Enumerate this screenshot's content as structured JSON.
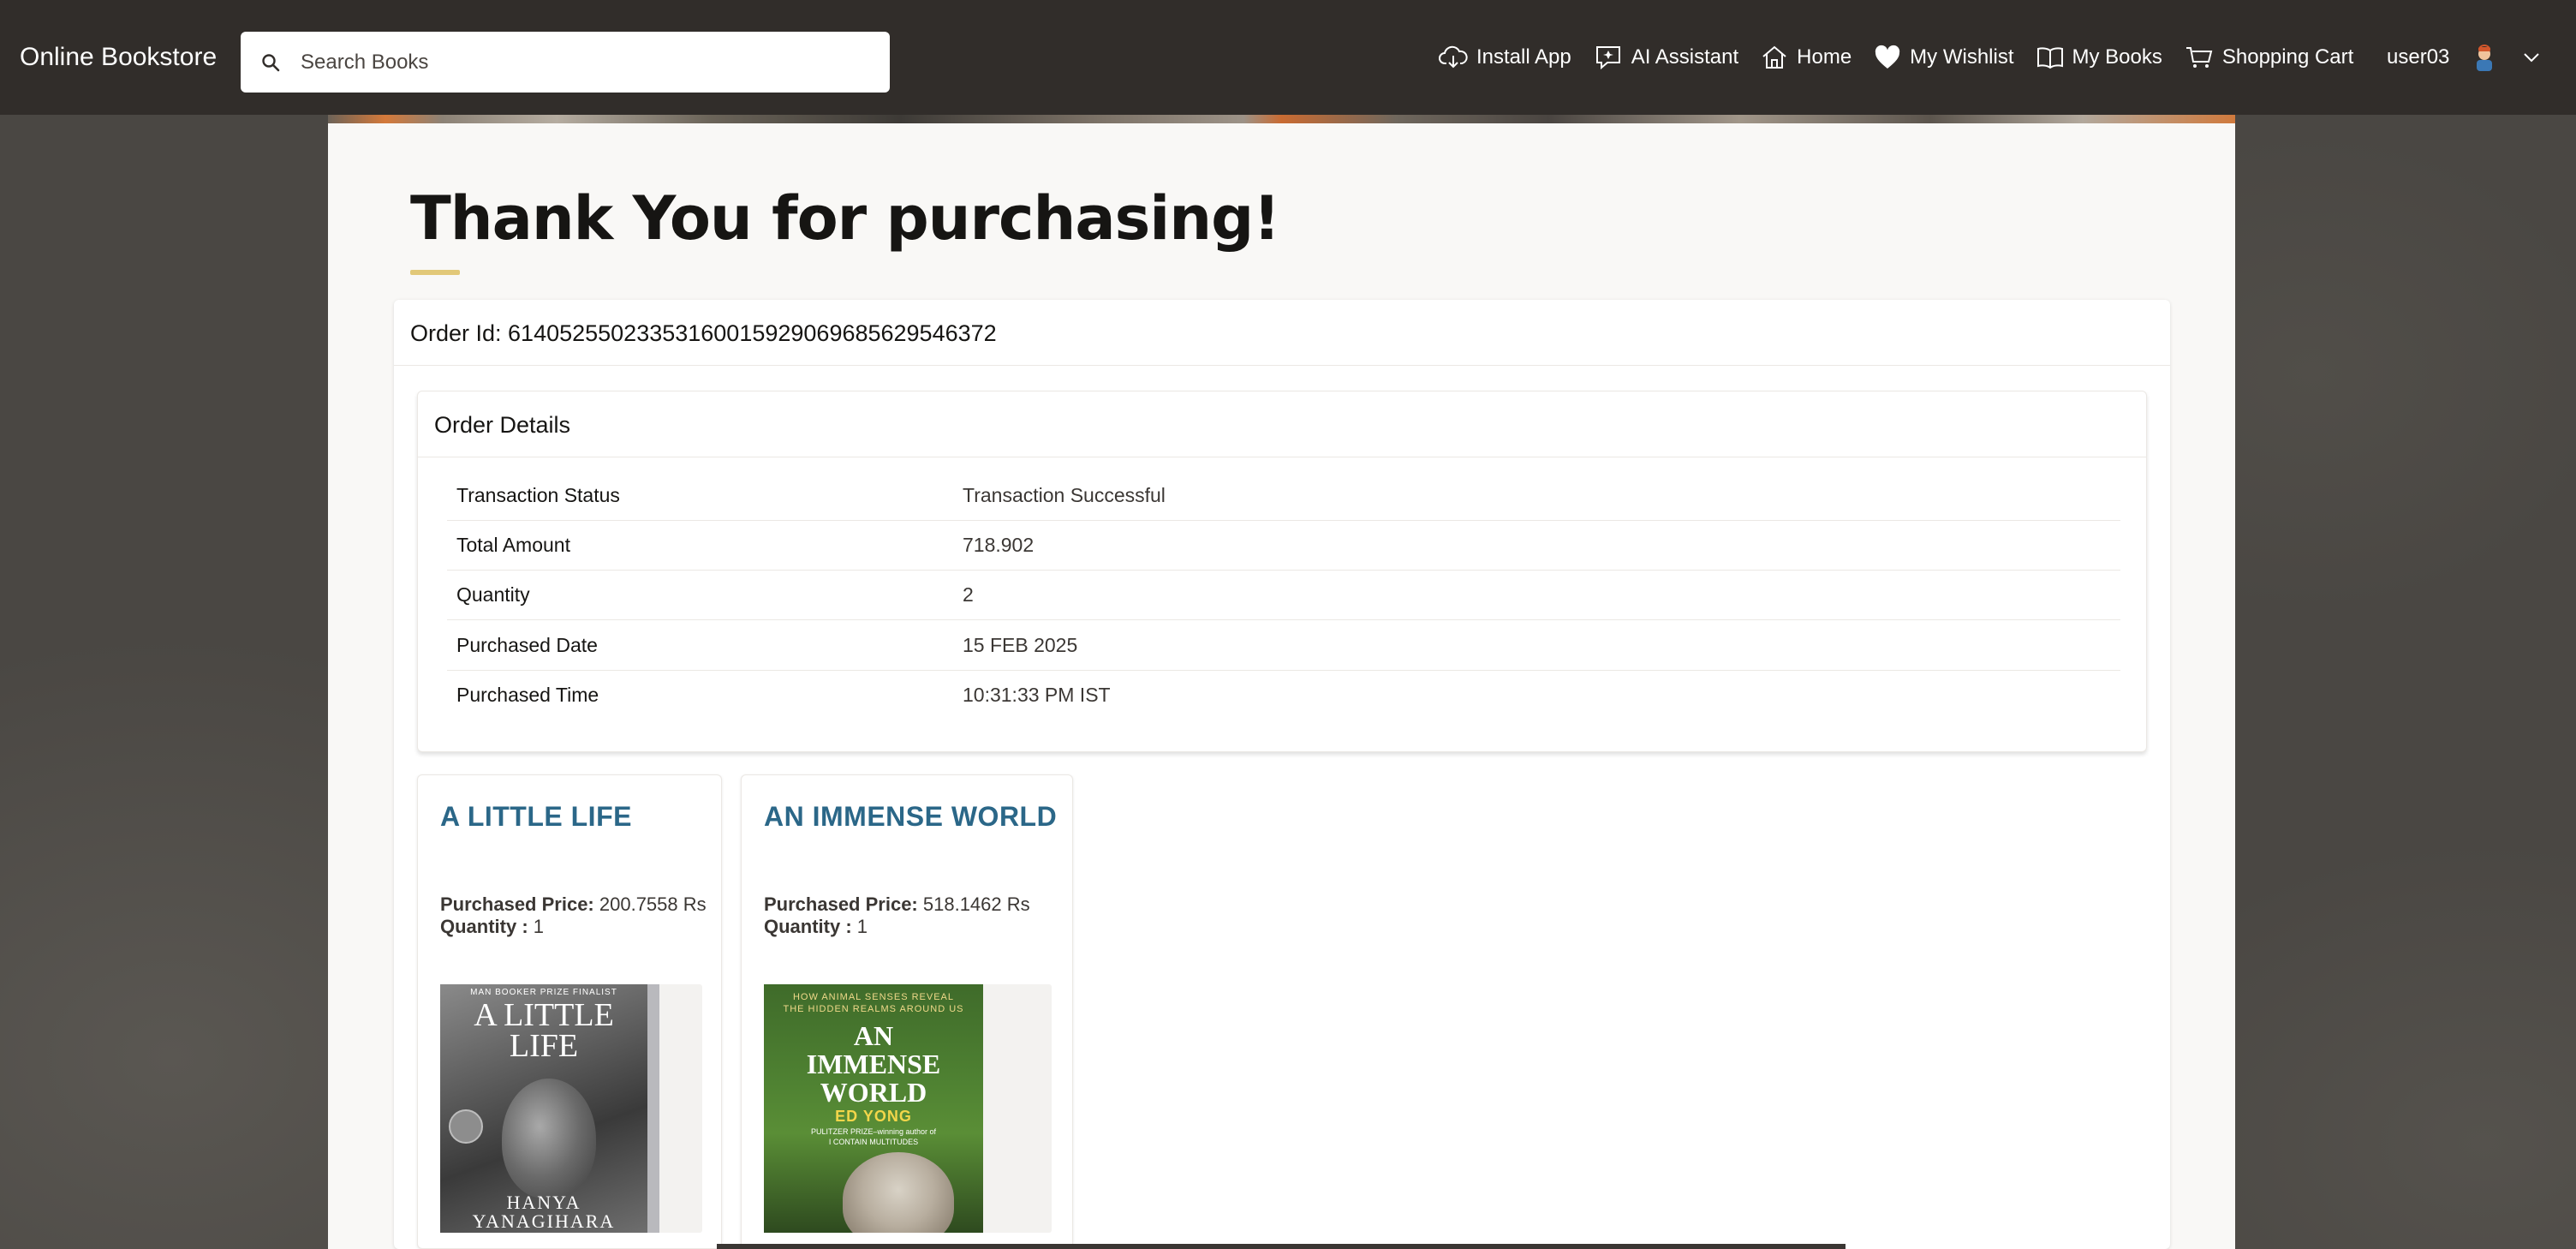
{
  "header": {
    "brand": "Online Bookstore",
    "search_placeholder": "Search Books",
    "nav": [
      {
        "label": "Install App",
        "icon": "cloud-download-icon"
      },
      {
        "label": "AI Assistant",
        "icon": "ai-chat-icon"
      },
      {
        "label": "Home",
        "icon": "home-icon"
      },
      {
        "label": "My Wishlist",
        "icon": "heart-icon"
      },
      {
        "label": "My Books",
        "icon": "open-book-icon"
      },
      {
        "label": "Shopping Cart",
        "icon": "cart-icon"
      }
    ],
    "username": "user03"
  },
  "page": {
    "title": "Thank You for purchasing!"
  },
  "order": {
    "id_text": "Order Id: 614052550233531600159290696856295463​72",
    "details_title": "Order Details",
    "rows": [
      {
        "label": "Transaction Status",
        "value": "Transaction Successful"
      },
      {
        "label": "Total Amount",
        "value": "718.902"
      },
      {
        "label": "Quantity",
        "value": "2"
      },
      {
        "label": "Purchased Date",
        "value": "15 FEB 2025"
      },
      {
        "label": "Purchased Time",
        "value": "10:31:33 PM IST"
      }
    ]
  },
  "books": [
    {
      "title": "A LITTLE LIFE",
      "price_label": "Purchased Price:",
      "price_value": "200.7558 Rs",
      "qty_label": "Quantity :",
      "qty_value": "1",
      "cover": {
        "top": "MAN BOOKER PRIZE FINALIST",
        "title_line1": "A LITTLE",
        "title_line2": "LIFE",
        "author_line1": "HANYA",
        "author_line2": "YANAGIHARA"
      }
    },
    {
      "title": "AN IMMENSE WORLD",
      "price_label": "Purchased Price:",
      "price_value": "518.1462 Rs",
      "qty_label": "Quantity :",
      "qty_value": "1",
      "cover": {
        "top": "HOW ANIMAL SENSES REVEAL",
        "top2": "THE HIDDEN REALMS AROUND US",
        "title_line1": "AN",
        "title_line2": "IMMENSE",
        "title_line3": "WORLD",
        "author": "ED YONG",
        "tagline": "PULITZER PRIZE–winning author of",
        "tagline2": "I CONTAIN MULTITUDES"
      }
    }
  ]
}
